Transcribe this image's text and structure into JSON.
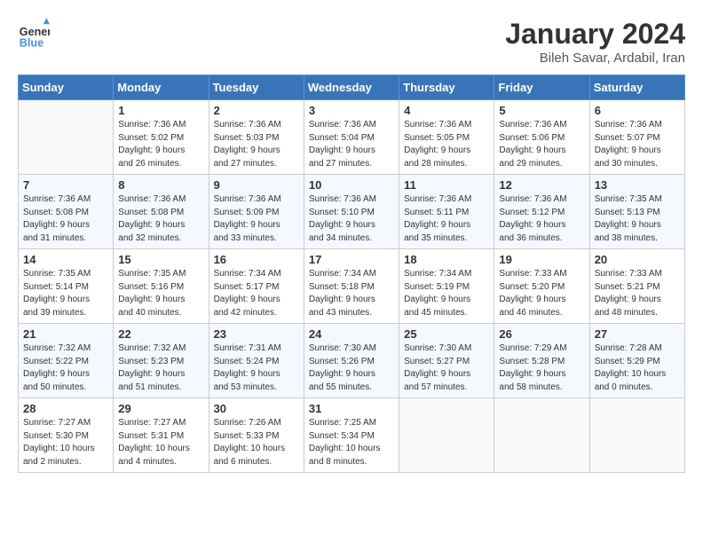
{
  "header": {
    "logo_line1": "General",
    "logo_line2": "Blue",
    "month": "January 2024",
    "location": "Bileh Savar, Ardabil, Iran"
  },
  "weekdays": [
    "Sunday",
    "Monday",
    "Tuesday",
    "Wednesday",
    "Thursday",
    "Friday",
    "Saturday"
  ],
  "weeks": [
    [
      {
        "day": "",
        "info": ""
      },
      {
        "day": "1",
        "info": "Sunrise: 7:36 AM\nSunset: 5:02 PM\nDaylight: 9 hours\nand 26 minutes."
      },
      {
        "day": "2",
        "info": "Sunrise: 7:36 AM\nSunset: 5:03 PM\nDaylight: 9 hours\nand 27 minutes."
      },
      {
        "day": "3",
        "info": "Sunrise: 7:36 AM\nSunset: 5:04 PM\nDaylight: 9 hours\nand 27 minutes."
      },
      {
        "day": "4",
        "info": "Sunrise: 7:36 AM\nSunset: 5:05 PM\nDaylight: 9 hours\nand 28 minutes."
      },
      {
        "day": "5",
        "info": "Sunrise: 7:36 AM\nSunset: 5:06 PM\nDaylight: 9 hours\nand 29 minutes."
      },
      {
        "day": "6",
        "info": "Sunrise: 7:36 AM\nSunset: 5:07 PM\nDaylight: 9 hours\nand 30 minutes."
      }
    ],
    [
      {
        "day": "7",
        "info": "Sunrise: 7:36 AM\nSunset: 5:08 PM\nDaylight: 9 hours\nand 31 minutes."
      },
      {
        "day": "8",
        "info": "Sunrise: 7:36 AM\nSunset: 5:08 PM\nDaylight: 9 hours\nand 32 minutes."
      },
      {
        "day": "9",
        "info": "Sunrise: 7:36 AM\nSunset: 5:09 PM\nDaylight: 9 hours\nand 33 minutes."
      },
      {
        "day": "10",
        "info": "Sunrise: 7:36 AM\nSunset: 5:10 PM\nDaylight: 9 hours\nand 34 minutes."
      },
      {
        "day": "11",
        "info": "Sunrise: 7:36 AM\nSunset: 5:11 PM\nDaylight: 9 hours\nand 35 minutes."
      },
      {
        "day": "12",
        "info": "Sunrise: 7:36 AM\nSunset: 5:12 PM\nDaylight: 9 hours\nand 36 minutes."
      },
      {
        "day": "13",
        "info": "Sunrise: 7:35 AM\nSunset: 5:13 PM\nDaylight: 9 hours\nand 38 minutes."
      }
    ],
    [
      {
        "day": "14",
        "info": "Sunrise: 7:35 AM\nSunset: 5:14 PM\nDaylight: 9 hours\nand 39 minutes."
      },
      {
        "day": "15",
        "info": "Sunrise: 7:35 AM\nSunset: 5:16 PM\nDaylight: 9 hours\nand 40 minutes."
      },
      {
        "day": "16",
        "info": "Sunrise: 7:34 AM\nSunset: 5:17 PM\nDaylight: 9 hours\nand 42 minutes."
      },
      {
        "day": "17",
        "info": "Sunrise: 7:34 AM\nSunset: 5:18 PM\nDaylight: 9 hours\nand 43 minutes."
      },
      {
        "day": "18",
        "info": "Sunrise: 7:34 AM\nSunset: 5:19 PM\nDaylight: 9 hours\nand 45 minutes."
      },
      {
        "day": "19",
        "info": "Sunrise: 7:33 AM\nSunset: 5:20 PM\nDaylight: 9 hours\nand 46 minutes."
      },
      {
        "day": "20",
        "info": "Sunrise: 7:33 AM\nSunset: 5:21 PM\nDaylight: 9 hours\nand 48 minutes."
      }
    ],
    [
      {
        "day": "21",
        "info": "Sunrise: 7:32 AM\nSunset: 5:22 PM\nDaylight: 9 hours\nand 50 minutes."
      },
      {
        "day": "22",
        "info": "Sunrise: 7:32 AM\nSunset: 5:23 PM\nDaylight: 9 hours\nand 51 minutes."
      },
      {
        "day": "23",
        "info": "Sunrise: 7:31 AM\nSunset: 5:24 PM\nDaylight: 9 hours\nand 53 minutes."
      },
      {
        "day": "24",
        "info": "Sunrise: 7:30 AM\nSunset: 5:26 PM\nDaylight: 9 hours\nand 55 minutes."
      },
      {
        "day": "25",
        "info": "Sunrise: 7:30 AM\nSunset: 5:27 PM\nDaylight: 9 hours\nand 57 minutes."
      },
      {
        "day": "26",
        "info": "Sunrise: 7:29 AM\nSunset: 5:28 PM\nDaylight: 9 hours\nand 58 minutes."
      },
      {
        "day": "27",
        "info": "Sunrise: 7:28 AM\nSunset: 5:29 PM\nDaylight: 10 hours\nand 0 minutes."
      }
    ],
    [
      {
        "day": "28",
        "info": "Sunrise: 7:27 AM\nSunset: 5:30 PM\nDaylight: 10 hours\nand 2 minutes."
      },
      {
        "day": "29",
        "info": "Sunrise: 7:27 AM\nSunset: 5:31 PM\nDaylight: 10 hours\nand 4 minutes."
      },
      {
        "day": "30",
        "info": "Sunrise: 7:26 AM\nSunset: 5:33 PM\nDaylight: 10 hours\nand 6 minutes."
      },
      {
        "day": "31",
        "info": "Sunrise: 7:25 AM\nSunset: 5:34 PM\nDaylight: 10 hours\nand 8 minutes."
      },
      {
        "day": "",
        "info": ""
      },
      {
        "day": "",
        "info": ""
      },
      {
        "day": "",
        "info": ""
      }
    ]
  ]
}
